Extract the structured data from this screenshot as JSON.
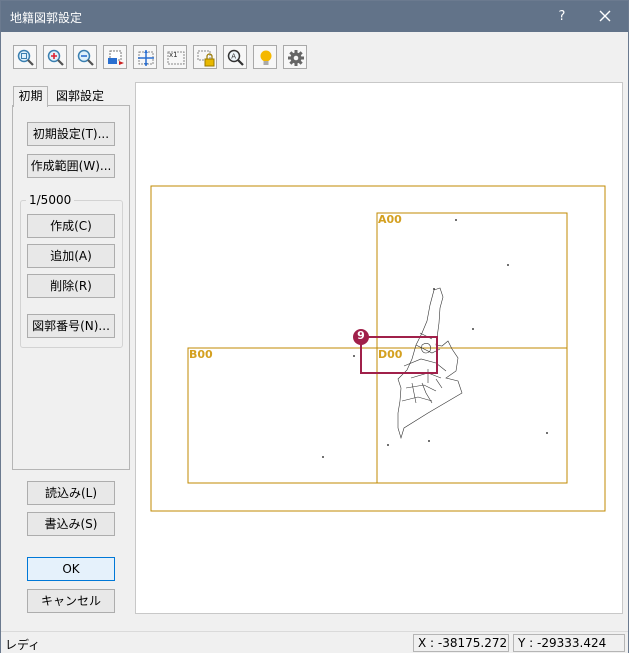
{
  "window": {
    "title": "地籍図郭設定",
    "help": "?",
    "close": "✕"
  },
  "toolbar": {
    "buttons": [
      {
        "icon": "zoom-fit-icon"
      },
      {
        "icon": "zoom-in-icon"
      },
      {
        "icon": "zoom-out-icon"
      },
      {
        "icon": "move-icon"
      },
      {
        "icon": "pan-icon"
      },
      {
        "icon": "scale-1x-icon"
      },
      {
        "icon": "scale-lock-icon"
      },
      {
        "icon": "zoom-area-icon"
      },
      {
        "icon": "hint-bulb-icon"
      },
      {
        "icon": "settings-gear-icon"
      }
    ],
    "scale_badge": "x1"
  },
  "tabs": {
    "initial": "初期",
    "sheet_settings": "図郭設定"
  },
  "left_panel": {
    "initial_settings": "初期設定(T)...",
    "creation_range": "作成範囲(W)...",
    "scale_group": "1/5000",
    "create": "作成(C)",
    "add": "追加(A)",
    "delete": "削除(R)",
    "sheet_number": "図郭番号(N)..."
  },
  "file_buttons": {
    "load": "読込み(L)",
    "write": "書込み(S)"
  },
  "dialog_buttons": {
    "ok": "OK",
    "cancel": "キャンセル"
  },
  "canvas": {
    "sheets": [
      {
        "label": "A00"
      },
      {
        "label": "B00"
      },
      {
        "label": "D00"
      }
    ],
    "callout_number": "9",
    "colors": {
      "sheet_border": "#c08a00",
      "sheet_label": "#d4a020",
      "callout": "#a0204a"
    }
  },
  "status": {
    "text": "レディ",
    "x": "X : -38175.272",
    "y": "Y : -29333.424"
  }
}
